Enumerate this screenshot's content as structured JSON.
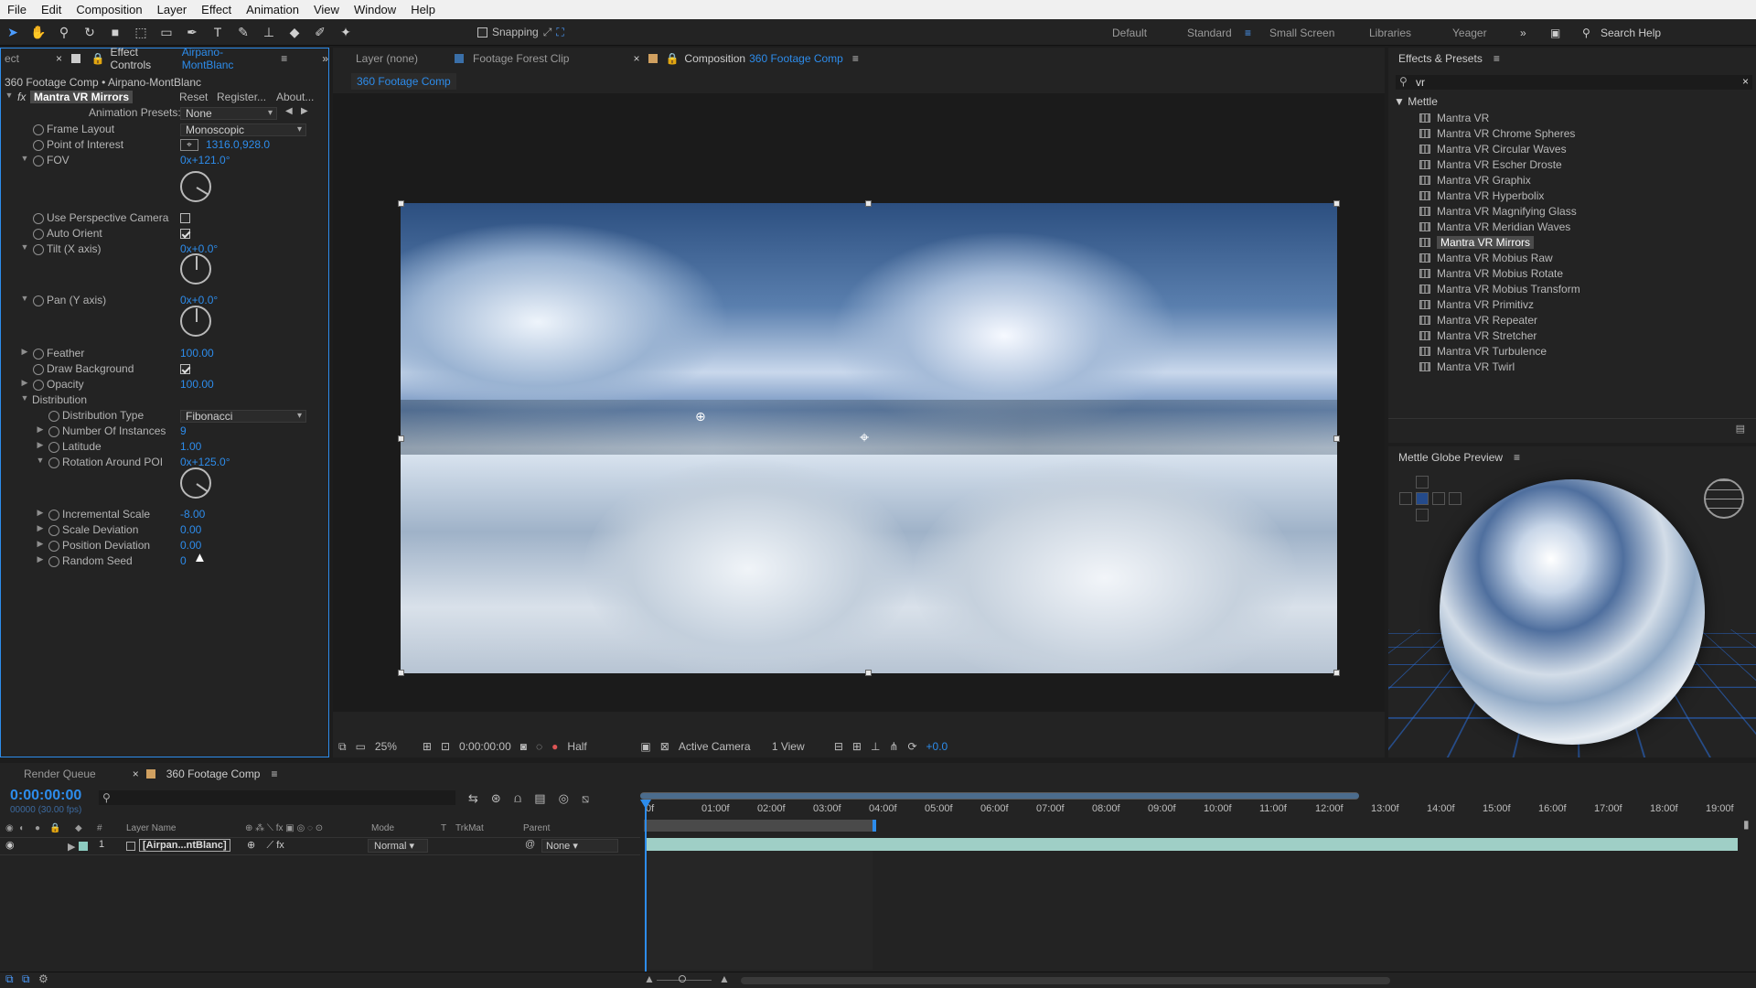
{
  "menu": [
    "File",
    "Edit",
    "Composition",
    "Layer",
    "Effect",
    "Animation",
    "View",
    "Window",
    "Help"
  ],
  "toolbar": {
    "snapping": "Snapping",
    "workspaces": [
      "Default",
      "Standard",
      "Small Screen",
      "Libraries",
      "Yeager"
    ],
    "search": "Search Help"
  },
  "effect_controls": {
    "tab_left": "ect",
    "tab_prefix": "Effect Controls",
    "tab_layer": "Airpano-MontBlanc",
    "breadcrumb": "360 Footage Comp • Airpano-MontBlanc",
    "fx_label": "fx",
    "effect_name": "Mantra VR Mirrors",
    "reset": "Reset",
    "register": "Register...",
    "about": "About...",
    "presets_label": "Animation Presets:",
    "presets_value": "None",
    "frame_layout": {
      "name": "Frame Layout",
      "value": "Monoscopic"
    },
    "poi": {
      "name": "Point of Interest",
      "value": "1316.0,928.0"
    },
    "fov": {
      "name": "FOV",
      "value": "0x+121.0°"
    },
    "use_persp": {
      "name": "Use Perspective Camera"
    },
    "auto_orient": {
      "name": "Auto Orient"
    },
    "tilt": {
      "name": "Tilt (X axis)",
      "value": "0x+0.0°"
    },
    "pan": {
      "name": "Pan (Y axis)",
      "value": "0x+0.0°"
    },
    "feather": {
      "name": "Feather",
      "value": "100.00"
    },
    "draw_bg": {
      "name": "Draw Background"
    },
    "opacity": {
      "name": "Opacity",
      "value": "100.00"
    },
    "distribution": {
      "name": "Distribution"
    },
    "dist_type": {
      "name": "Distribution Type",
      "value": "Fibonacci"
    },
    "instances": {
      "name": "Number Of Instances",
      "value": "9"
    },
    "latitude": {
      "name": "Latitude",
      "value": "1.00"
    },
    "rotation_poi": {
      "name": "Rotation Around POI",
      "value": "0x+125.0°"
    },
    "inc_scale": {
      "name": "Incremental Scale",
      "value": "-8.00"
    },
    "scale_dev": {
      "name": "Scale Deviation",
      "value": "0.00"
    },
    "pos_dev": {
      "name": "Position Deviation",
      "value": "0.00"
    },
    "seed": {
      "name": "Random Seed",
      "value": "0"
    }
  },
  "comp_tabs": {
    "layer": "Layer (none)",
    "footage": "Footage Forest Clip",
    "comp_prefix": "Composition",
    "comp_name": "360 Footage Comp",
    "sub": "360 Footage Comp"
  },
  "viewer_bar": {
    "zoom": "25%",
    "timecode": "0:00:00:00",
    "resolution": "Half",
    "camera": "Active Camera",
    "views": "1 View",
    "exposure": "+0.0"
  },
  "effects_presets": {
    "title": "Effects & Presets",
    "search": "vr",
    "group": "Mettle",
    "items": [
      "Mantra VR",
      "Mantra VR Chrome Spheres",
      "Mantra VR Circular Waves",
      "Mantra VR Escher Droste",
      "Mantra VR Graphix",
      "Mantra VR Hyperbolix",
      "Mantra VR Magnifying Glass",
      "Mantra VR Meridian Waves",
      "Mantra VR Mirrors",
      "Mantra VR Mobius Raw",
      "Mantra VR Mobius Rotate",
      "Mantra VR Mobius Transform",
      "Mantra VR Primitivz",
      "Mantra VR Repeater",
      "Mantra VR Stretcher",
      "Mantra VR Turbulence",
      "Mantra VR Twirl"
    ],
    "selected": "Mantra VR Mirrors"
  },
  "globe": {
    "title": "Mettle Globe Preview"
  },
  "timeline": {
    "tab_queue": "Render Queue",
    "tab_comp": "360 Footage Comp",
    "timecode": "0:00:00:00",
    "fps": "00000 (30.00 fps)",
    "cols": {
      "num": "#",
      "layer_name": "Layer Name",
      "mode": "Mode",
      "t": "T",
      "trkmat": "TrkMat",
      "parent": "Parent"
    },
    "layer": {
      "num": "1",
      "name": "[Airpan...ntBlanc]",
      "mode": "Normal",
      "parent": "None"
    },
    "ticks": [
      "0f",
      "01:00f",
      "02:00f",
      "03:00f",
      "04:00f",
      "05:00f",
      "06:00f",
      "07:00f",
      "08:00f",
      "09:00f",
      "10:00f",
      "11:00f",
      "12:00f",
      "13:00f",
      "14:00f",
      "15:00f",
      "16:00f",
      "17:00f",
      "18:00f",
      "19:00f"
    ]
  },
  "colors": {
    "accent": "#2d8ceb",
    "panel": "#232323",
    "bg": "#1d1d1d",
    "layer_bar": "#9fcfc6",
    "selection": "#4b4b4b"
  }
}
